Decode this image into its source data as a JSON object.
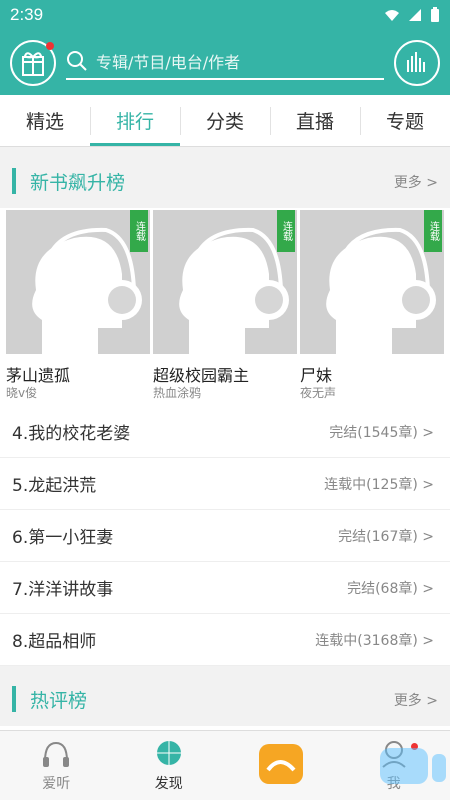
{
  "status_bar": {
    "time": "2:39"
  },
  "header": {
    "search_placeholder": "专辑/节目/电台/作者"
  },
  "tabs": [
    {
      "label": "精选"
    },
    {
      "label": "排行"
    },
    {
      "label": "分类"
    },
    {
      "label": "直播"
    },
    {
      "label": "专题"
    }
  ],
  "sections": [
    {
      "title": "新书飙升榜",
      "more": "更多 >"
    },
    {
      "title": "热评榜",
      "more": "更多 >"
    }
  ],
  "cards": [
    {
      "title": "茅山遗孤",
      "author": "晓v俊",
      "badge": "连载"
    },
    {
      "title": "超级校园霸主",
      "author": "热血涂鸦",
      "badge": "连载"
    },
    {
      "title": "尸妹",
      "author": "夜无声",
      "badge": "连载"
    }
  ],
  "rank_list": [
    {
      "title": "4.我的校花老婆",
      "status": "完结(1545章) >"
    },
    {
      "title": "5.龙起洪荒",
      "status": "连载中(125章) >"
    },
    {
      "title": "6.第一小狂妻",
      "status": "完结(167章) >"
    },
    {
      "title": "7.洋洋讲故事",
      "status": "完结(68章) >"
    },
    {
      "title": "8.超品相师",
      "status": "连载中(3168章) >"
    }
  ],
  "bottom_nav": [
    {
      "label": "爱听"
    },
    {
      "label": "发现"
    },
    {
      "label": ""
    },
    {
      "label": "我"
    }
  ],
  "colors": {
    "accent": "#35b4a6",
    "ribbon": "#33a94a"
  }
}
